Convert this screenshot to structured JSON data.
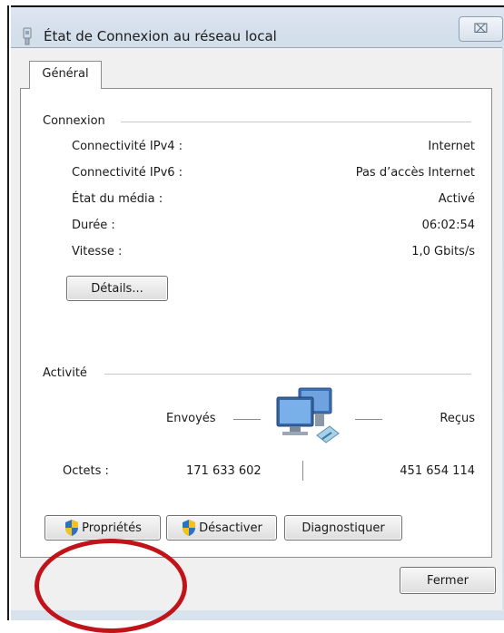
{
  "window": {
    "title": "État de Connexion au réseau local",
    "close_symbol": "⌧"
  },
  "tabs": [
    {
      "label": "Général"
    }
  ],
  "connexion": {
    "group_label": "Connexion",
    "rows": [
      {
        "label": "Connectivité IPv4 :",
        "value": "Internet"
      },
      {
        "label": "Connectivité IPv6 :",
        "value": "Pas d’accès Internet"
      },
      {
        "label": "État du média :",
        "value": "Activé"
      },
      {
        "label": "Durée :",
        "value": "06:02:54"
      },
      {
        "label": "Vitesse :",
        "value": "1,0 Gbits/s"
      }
    ],
    "details_button": "Détails..."
  },
  "activite": {
    "group_label": "Activité",
    "sent_label": "Envoyés",
    "received_label": "Reçus",
    "bytes_label": "Octets :",
    "bytes_sent": "171 633 602",
    "bytes_received": "451 654 114"
  },
  "buttons": {
    "properties": "Propriétés",
    "disable": "Désactiver",
    "diagnose": "Diagnostiquer",
    "close": "Fermer"
  },
  "colors": {
    "annotation_ellipse": "#c0141a",
    "window_frame": "#d4dfec"
  },
  "icons": [
    "network-adapter-icon",
    "shield-icon",
    "network-computers-icon",
    "close-icon"
  ]
}
